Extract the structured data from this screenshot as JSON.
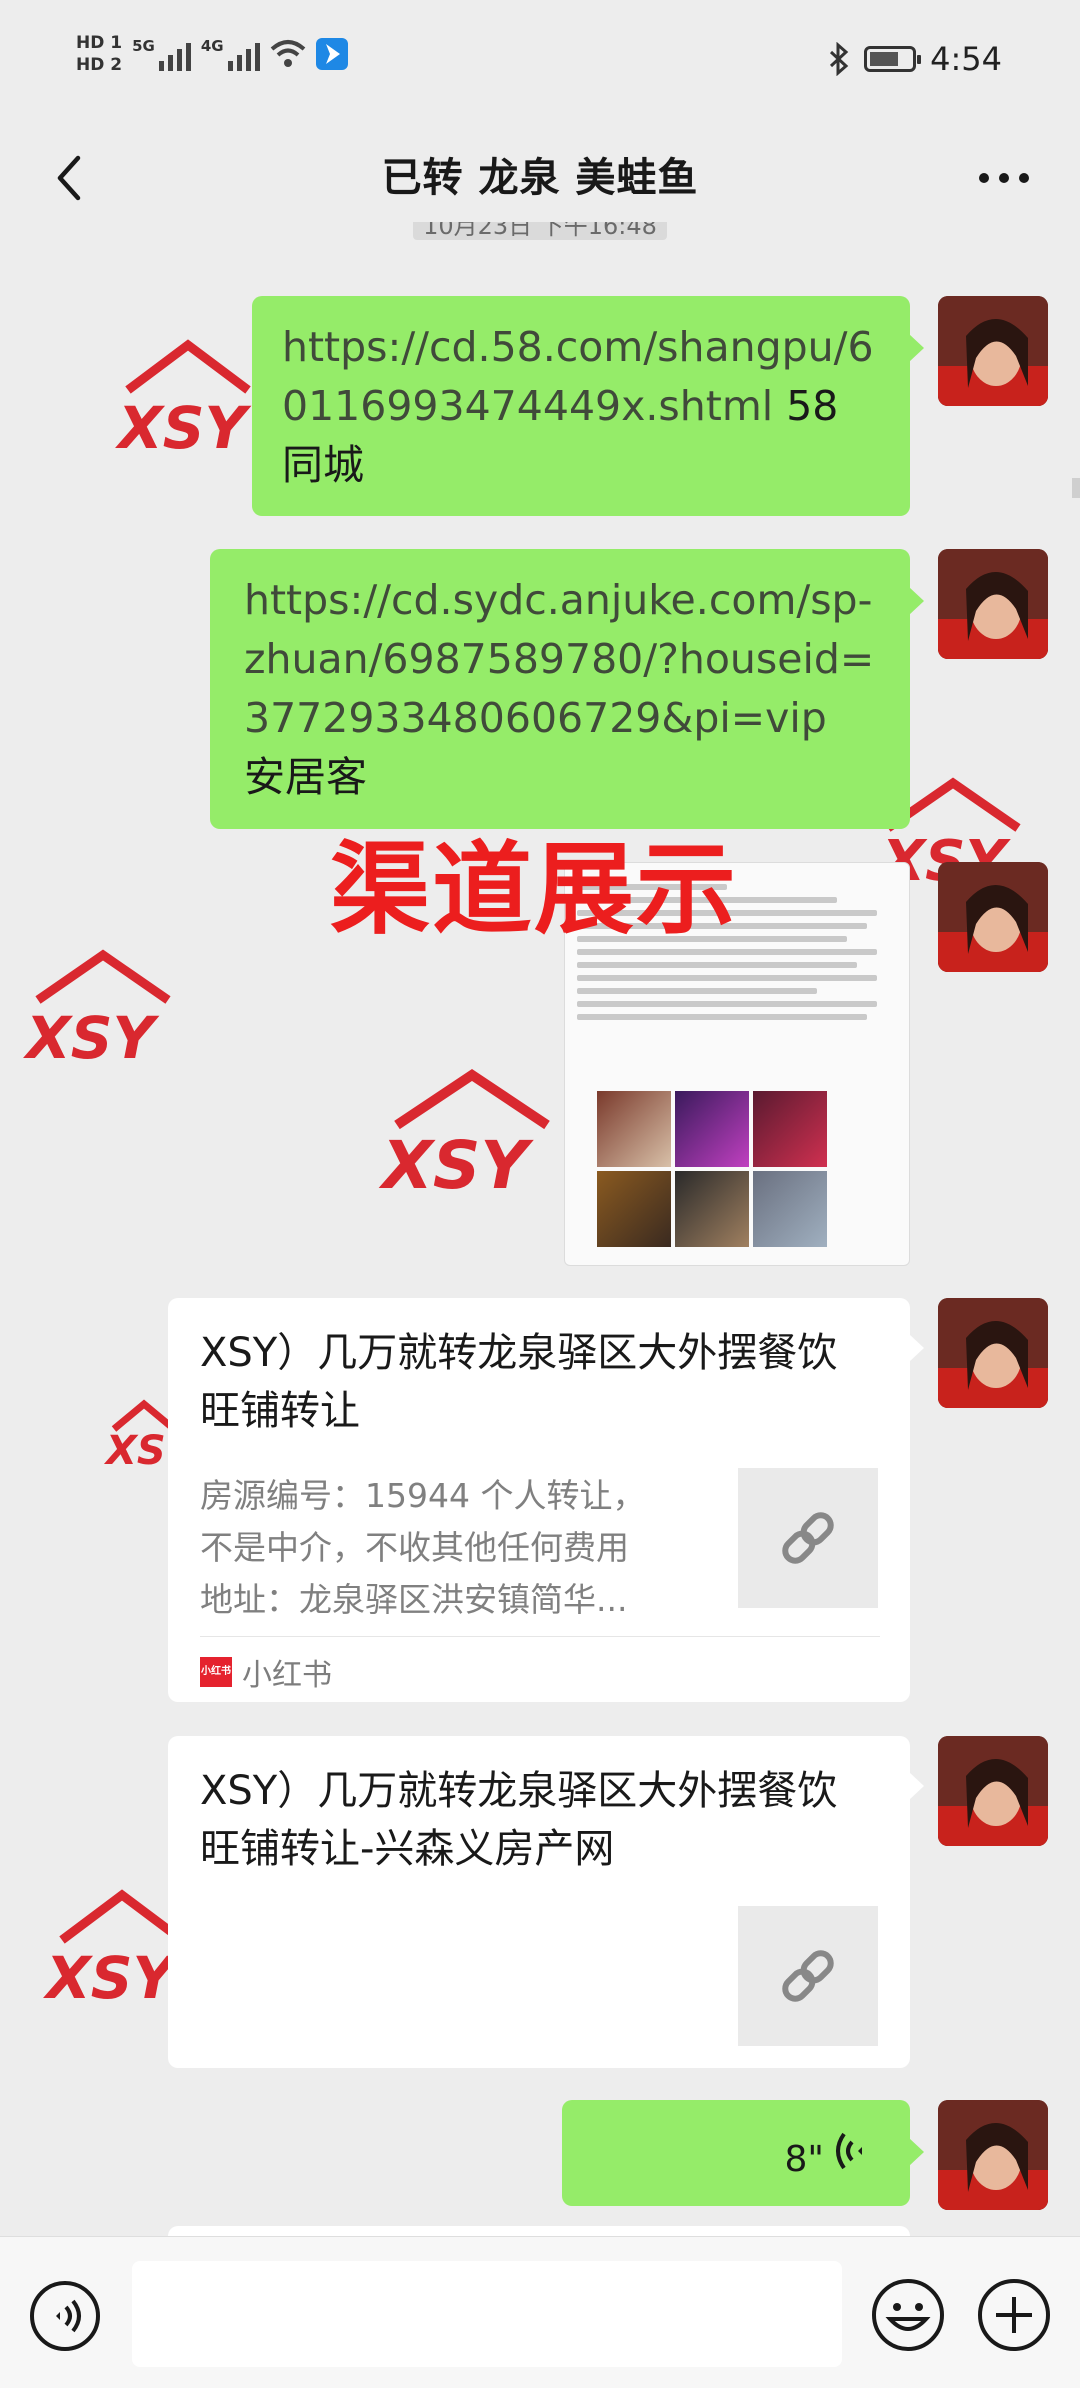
{
  "status_bar": {
    "hd1": "HD 1",
    "hd2": "HD 2",
    "net1": "5G",
    "net2": "4G",
    "time": "4:54",
    "icons": [
      "signal-icon",
      "wifi-icon",
      "app-notification-icon",
      "bluetooth-icon",
      "battery-icon"
    ]
  },
  "nav": {
    "title": "已转 龙泉 美蛙鱼",
    "back_icon": "back-arrow-icon",
    "more_icon": "more-icon"
  },
  "timestamp": "10月23日 下午16:48",
  "watermark_text": "XSY",
  "messages": [
    {
      "type": "link_text",
      "text": "https://cd.58.com/shangpu/60116993474449x.shtml",
      "suffix": "58 同城"
    },
    {
      "type": "link_text",
      "text": "https://cd.sydc.anjuke.com/sp-zhuan/6987589780/?houseid=3772933480606729&pi=vip",
      "suffix": "安居客"
    },
    {
      "type": "image",
      "overlay": "渠道展示"
    },
    {
      "type": "card",
      "title": "XSY）几万就转龙泉驿区大外摆餐饮旺铺转让",
      "desc": [
        "房源编号：15944 个人转让，",
        "不是中介，不收其他任何费用",
        "地址：龙泉驿区洪安镇简华..."
      ],
      "source": "小红书",
      "source_logo": "小红书",
      "thumb_icon": "link-icon"
    },
    {
      "type": "card",
      "title": "XSY）几万就转龙泉驿区大外摆餐饮旺铺转让-兴森义房产网",
      "thumb_icon": "link-icon"
    },
    {
      "type": "voice",
      "duration": "8\""
    }
  ],
  "input_bar": {
    "voice_icon": "voice-input-icon",
    "emoji_icon": "emoji-icon",
    "plus_icon": "plus-icon"
  },
  "colors": {
    "background": "#ededed",
    "bubble_green": "#95ec69",
    "card_white": "#ffffff",
    "watermark_red": "#d9282f",
    "overlay_red": "#ec1e1e"
  }
}
